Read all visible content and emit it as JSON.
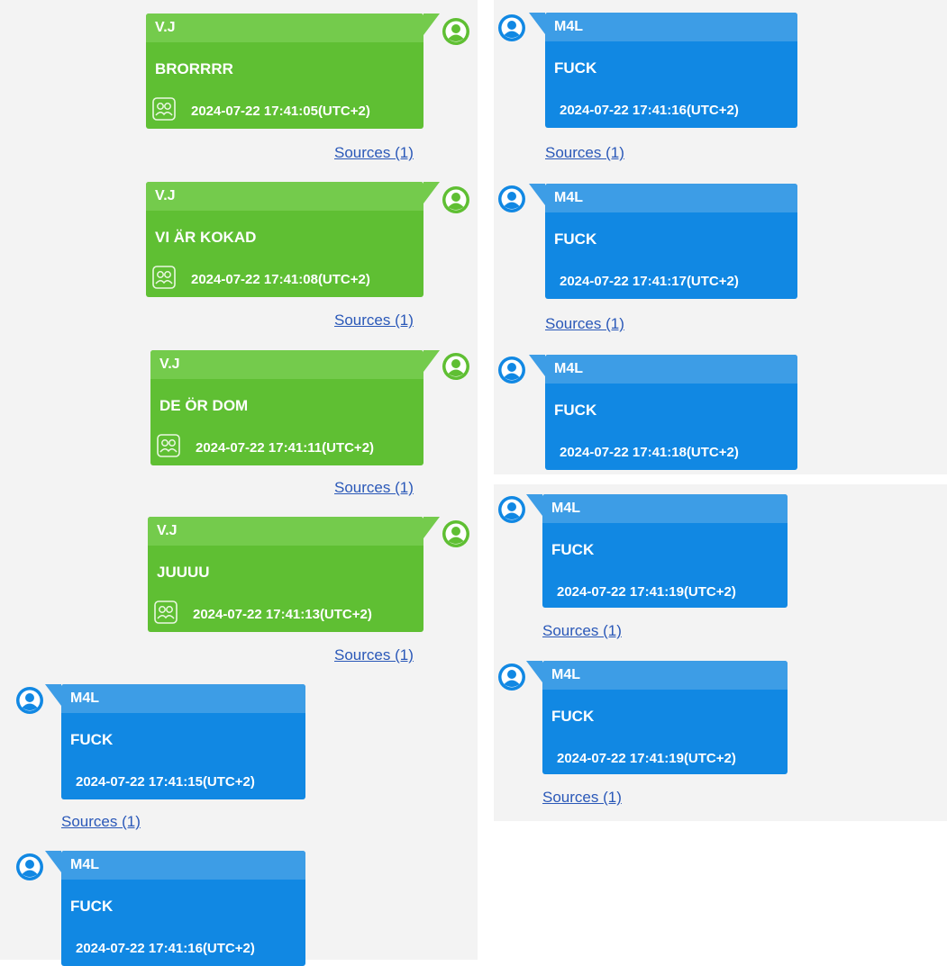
{
  "colors": {
    "outgoing_bubble": "#5fbf33",
    "outgoing_header": "#74cb4c",
    "incoming_bubble": "#1188e3",
    "incoming_header": "#3d9de6",
    "link": "#2a58b8",
    "panel_bg": "#f3f3f3"
  },
  "icons": {
    "avatar": "user-avatar-icon",
    "group": "group-icon"
  },
  "left_panel": {
    "messages": [
      {
        "sender": "V.J",
        "text": "BRORRRR",
        "timestamp": "2024-07-22 17:41:05(UTC+2)",
        "sources": "Sources (1)"
      },
      {
        "sender": "V.J",
        "text": "VI ÄR KOKAD",
        "timestamp": "2024-07-22 17:41:08(UTC+2)",
        "sources": "Sources (1)"
      },
      {
        "sender": "V.J",
        "text": "DE ÖR DOM",
        "timestamp": "2024-07-22 17:41:11(UTC+2)",
        "sources": "Sources (1)"
      },
      {
        "sender": "V.J",
        "text": "JUUUU",
        "timestamp": "2024-07-22 17:41:13(UTC+2)",
        "sources": "Sources (1)"
      },
      {
        "sender": "M4L",
        "text": "FUCK",
        "timestamp": "2024-07-22 17:41:15(UTC+2)",
        "sources": "Sources (1)"
      },
      {
        "sender": "M4L",
        "text": "FUCK",
        "timestamp": "2024-07-22 17:41:16(UTC+2)"
      }
    ]
  },
  "right_top_panel": {
    "messages": [
      {
        "sender": "M4L",
        "text": "FUCK",
        "timestamp": "2024-07-22 17:41:16(UTC+2)",
        "sources": "Sources (1)"
      },
      {
        "sender": "M4L",
        "text": "FUCK",
        "timestamp": "2024-07-22 17:41:17(UTC+2)",
        "sources": "Sources (1)"
      },
      {
        "sender": "M4L",
        "text": "FUCK",
        "timestamp": "2024-07-22 17:41:18(UTC+2)"
      }
    ]
  },
  "right_bottom_panel": {
    "messages": [
      {
        "sender": "M4L",
        "text": "FUCK",
        "timestamp": "2024-07-22 17:41:19(UTC+2)",
        "sources": "Sources (1)"
      },
      {
        "sender": "M4L",
        "text": "FUCK",
        "timestamp": "2024-07-22 17:41:19(UTC+2)",
        "sources": "Sources (1)"
      }
    ]
  }
}
